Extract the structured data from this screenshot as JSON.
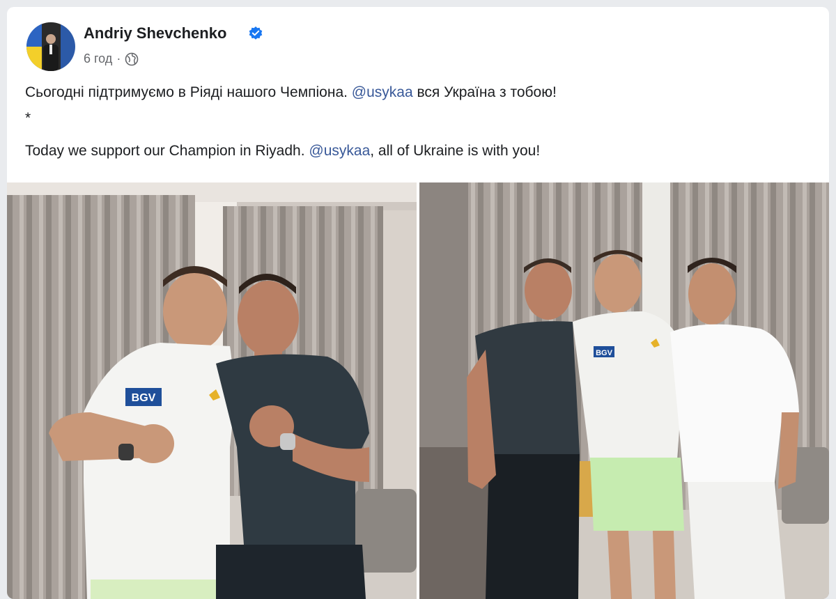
{
  "post": {
    "author": "Andriy Shevchenko",
    "timestamp": "6 год",
    "separator": "·",
    "text_ua_before": "Сьогодні підтримуємо в Ріяді нашого Чемпіона. ",
    "mention_ua": "@usykaa",
    "text_ua_after": " вся Україна з тобою!",
    "divider": "*",
    "text_en_before": "Today we support our Champion in Riyadh. ",
    "mention_en": "@usykaa",
    "text_en_after": ", all of Ukraine is with you!"
  },
  "photos": {
    "left_logo": "BGV",
    "right_logo": "BGV"
  },
  "colors": {
    "verified": "#1877f2",
    "mention": "#385898",
    "name": "#1c1e21",
    "meta": "#65676b"
  },
  "icons": [
    "verified-badge-icon",
    "globe-icon"
  ]
}
